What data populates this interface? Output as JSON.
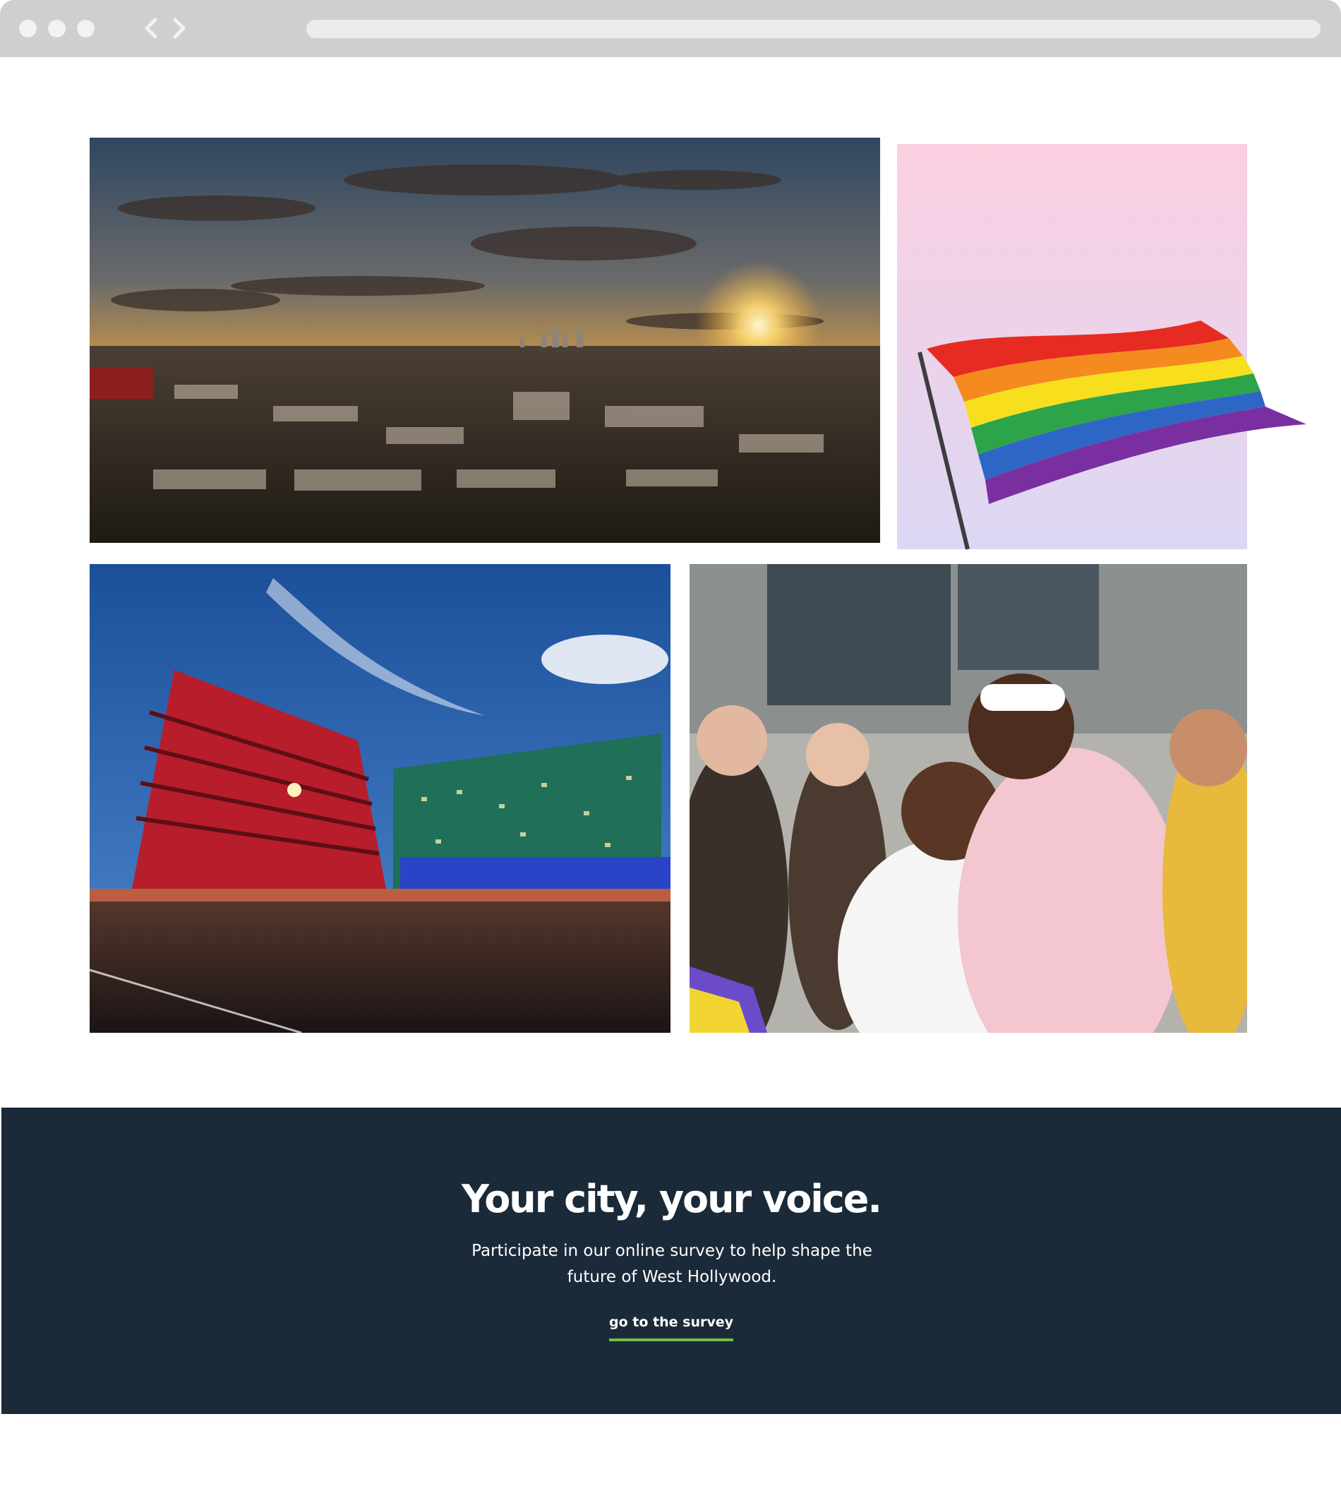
{
  "browser": {
    "nav_icons": [
      "back-arrow-icon",
      "forward-arrow-icon"
    ],
    "window_controls": [
      "close-dot",
      "minimize-dot",
      "maximize-dot"
    ]
  },
  "gallery": {
    "photos": [
      {
        "subject": "aerial-city-sunset-photo"
      },
      {
        "subject": "rainbow-pride-flag-photo"
      },
      {
        "subject": "pacific-design-center-photo"
      },
      {
        "subject": "pride-parade-crowd-photo"
      }
    ]
  },
  "cta": {
    "title": "Your city, your voice.",
    "text": "Participate in our online survey to help shape the future of West Hollywood.",
    "link_label": "go to the survey",
    "background_color": "#1b2a38",
    "accent_color": "#6fbf4b"
  }
}
